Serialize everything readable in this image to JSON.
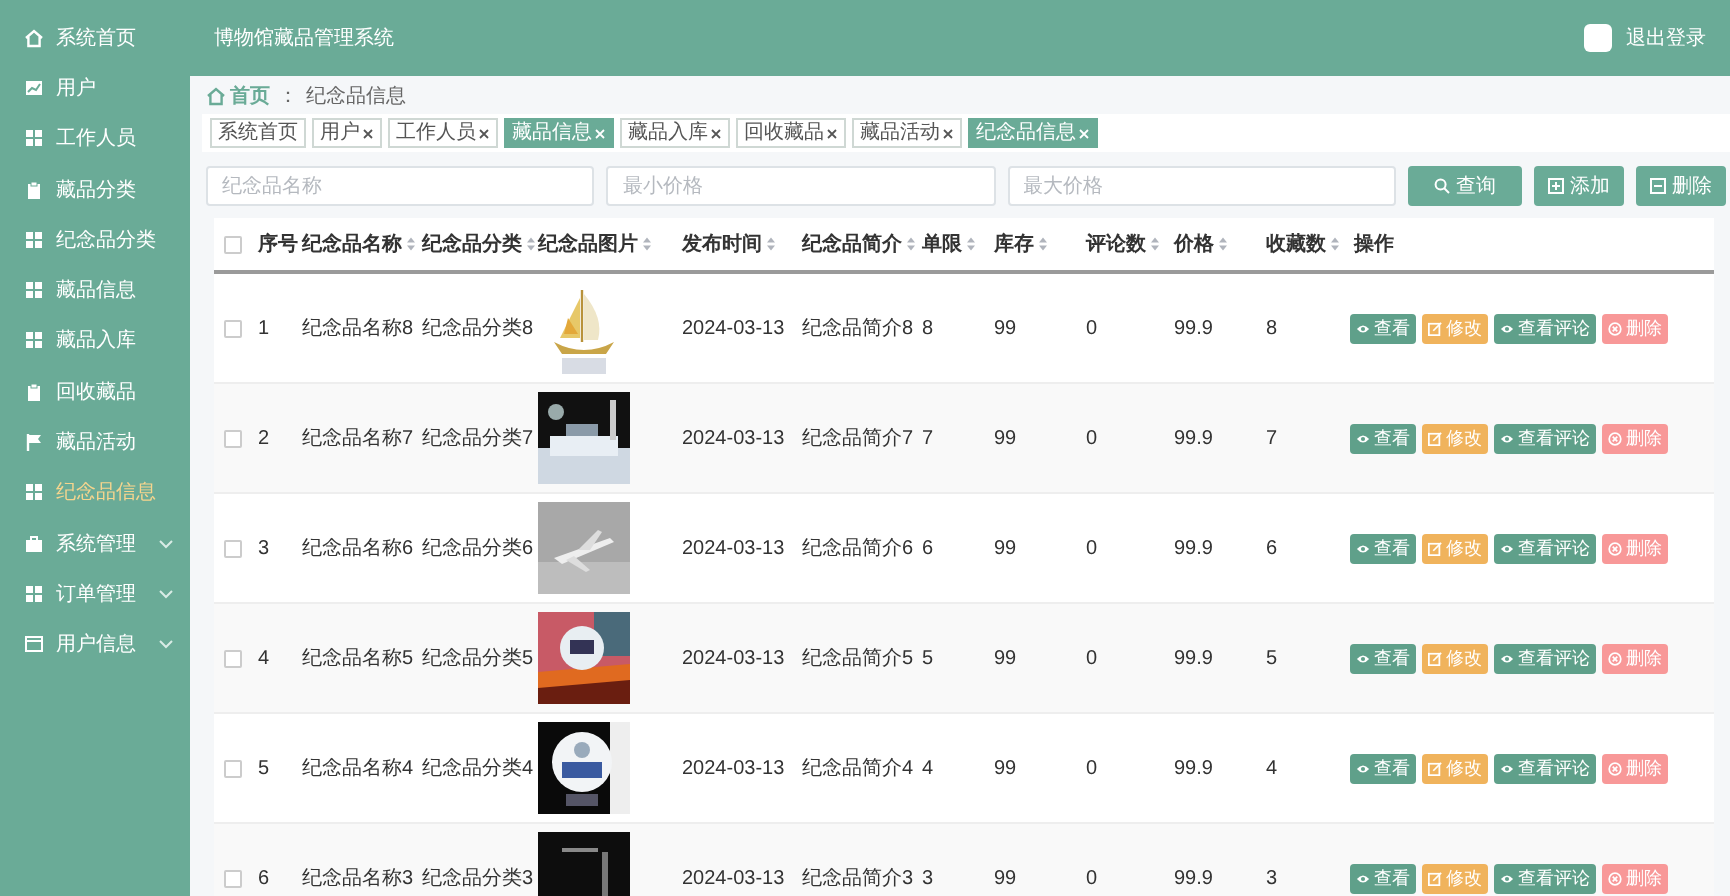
{
  "sidebar": {
    "items": [
      {
        "label": "系统首页",
        "selected": false,
        "expandable": false
      },
      {
        "label": "用户",
        "selected": false,
        "expandable": false
      },
      {
        "label": "工作人员",
        "selected": false,
        "expandable": false
      },
      {
        "label": "藏品分类",
        "selected": false,
        "expandable": false
      },
      {
        "label": "纪念品分类",
        "selected": false,
        "expandable": false
      },
      {
        "label": "藏品信息",
        "selected": false,
        "expandable": false
      },
      {
        "label": "藏品入库",
        "selected": false,
        "expandable": false
      },
      {
        "label": "回收藏品",
        "selected": false,
        "expandable": false
      },
      {
        "label": "藏品活动",
        "selected": false,
        "expandable": false
      },
      {
        "label": "纪念品信息",
        "selected": true,
        "expandable": false
      },
      {
        "label": "系统管理",
        "selected": false,
        "expandable": true
      },
      {
        "label": "订单管理",
        "selected": false,
        "expandable": true
      },
      {
        "label": "用户信息",
        "selected": false,
        "expandable": true
      }
    ]
  },
  "header": {
    "title": "博物馆藏品管理系统",
    "logout": "退出登录"
  },
  "breadcrumb": {
    "home": "首页",
    "separator": "：",
    "current": "纪念品信息"
  },
  "tags": [
    {
      "label": "系统首页",
      "closable": false,
      "selected": false
    },
    {
      "label": "用户",
      "closable": true,
      "selected": false
    },
    {
      "label": "工作人员",
      "closable": true,
      "selected": false
    },
    {
      "label": "藏品信息",
      "closable": true,
      "selected": true
    },
    {
      "label": "藏品入库",
      "closable": true,
      "selected": false
    },
    {
      "label": "回收藏品",
      "closable": true,
      "selected": false
    },
    {
      "label": "藏品活动",
      "closable": true,
      "selected": false
    },
    {
      "label": "纪念品信息",
      "closable": true,
      "selected": true
    }
  ],
  "search": {
    "fields": [
      {
        "placeholder": "纪念品名称"
      },
      {
        "placeholder": "最小价格"
      },
      {
        "placeholder": "最大价格"
      }
    ],
    "query_button": "查询",
    "add_button": "添加",
    "delete_button": "删除"
  },
  "table": {
    "select_all": {
      "checked": false
    },
    "columns": [
      {
        "label": "序号",
        "sortable": false
      },
      {
        "label": "纪念品名称",
        "sortable": true
      },
      {
        "label": "纪念品分类",
        "sortable": true
      },
      {
        "label": "纪念品图片",
        "sortable": true
      },
      {
        "label": "发布时间",
        "sortable": true
      },
      {
        "label": "纪念品简介",
        "sortable": true
      },
      {
        "label": "单限",
        "sortable": true
      },
      {
        "label": "库存",
        "sortable": true
      },
      {
        "label": "评论数",
        "sortable": true
      },
      {
        "label": "价格",
        "sortable": true
      },
      {
        "label": "收藏数",
        "sortable": true
      },
      {
        "label": "操作",
        "sortable": false
      }
    ],
    "rows": [
      {
        "checked": false,
        "cells": [
          "1",
          "纪念品名称8",
          "纪念品分类8",
          {
            "kind": "picture"
          },
          "2024-03-13",
          "纪念品简介8",
          "8",
          "99",
          "0",
          "99.9",
          "8"
        ],
        "actions": [
          {
            "kind": "view",
            "label": "查看"
          },
          {
            "kind": "edit",
            "label": "修改"
          },
          {
            "kind": "comments",
            "label": "查看评论"
          },
          {
            "kind": "delete",
            "label": "删除"
          }
        ]
      },
      {
        "checked": false,
        "cells": [
          "2",
          "纪念品名称7",
          "纪念品分类7",
          {
            "kind": "picture"
          },
          "2024-03-13",
          "纪念品简介7",
          "7",
          "99",
          "0",
          "99.9",
          "7"
        ],
        "actions": [
          {
            "kind": "view",
            "label": "查看"
          },
          {
            "kind": "edit",
            "label": "修改"
          },
          {
            "kind": "comments",
            "label": "查看评论"
          },
          {
            "kind": "delete",
            "label": "删除"
          }
        ]
      },
      {
        "checked": false,
        "cells": [
          "3",
          "纪念品名称6",
          "纪念品分类6",
          {
            "kind": "picture"
          },
          "2024-03-13",
          "纪念品简介6",
          "6",
          "99",
          "0",
          "99.9",
          "6"
        ],
        "actions": [
          {
            "kind": "view",
            "label": "查看"
          },
          {
            "kind": "edit",
            "label": "修改"
          },
          {
            "kind": "comments",
            "label": "查看评论"
          },
          {
            "kind": "delete",
            "label": "删除"
          }
        ]
      },
      {
        "checked": false,
        "cells": [
          "4",
          "纪念品名称5",
          "纪念品分类5",
          {
            "kind": "picture"
          },
          "2024-03-13",
          "纪念品简介5",
          "5",
          "99",
          "0",
          "99.9",
          "5"
        ],
        "actions": [
          {
            "kind": "view",
            "label": "查看"
          },
          {
            "kind": "edit",
            "label": "修改"
          },
          {
            "kind": "comments",
            "label": "查看评论"
          },
          {
            "kind": "delete",
            "label": "删除"
          }
        ]
      },
      {
        "checked": false,
        "cells": [
          "5",
          "纪念品名称4",
          "纪念品分类4",
          {
            "kind": "picture"
          },
          "2024-03-13",
          "纪念品简介4",
          "4",
          "99",
          "0",
          "99.9",
          "4"
        ],
        "actions": [
          {
            "kind": "view",
            "label": "查看"
          },
          {
            "kind": "edit",
            "label": "修改"
          },
          {
            "kind": "comments",
            "label": "查看评论"
          },
          {
            "kind": "delete",
            "label": "删除"
          }
        ]
      },
      {
        "checked": false,
        "cells": [
          "6",
          "纪念品名称3",
          "纪念品分类3",
          {
            "kind": "picture"
          },
          "2024-03-13",
          "纪念品简介3",
          "3",
          "99",
          "0",
          "99.9",
          "3"
        ],
        "actions": [
          {
            "kind": "view",
            "label": "查看"
          },
          {
            "kind": "edit",
            "label": "修改"
          },
          {
            "kind": "comments",
            "label": "查看评论"
          },
          {
            "kind": "delete",
            "label": "删除"
          }
        ]
      }
    ]
  }
}
